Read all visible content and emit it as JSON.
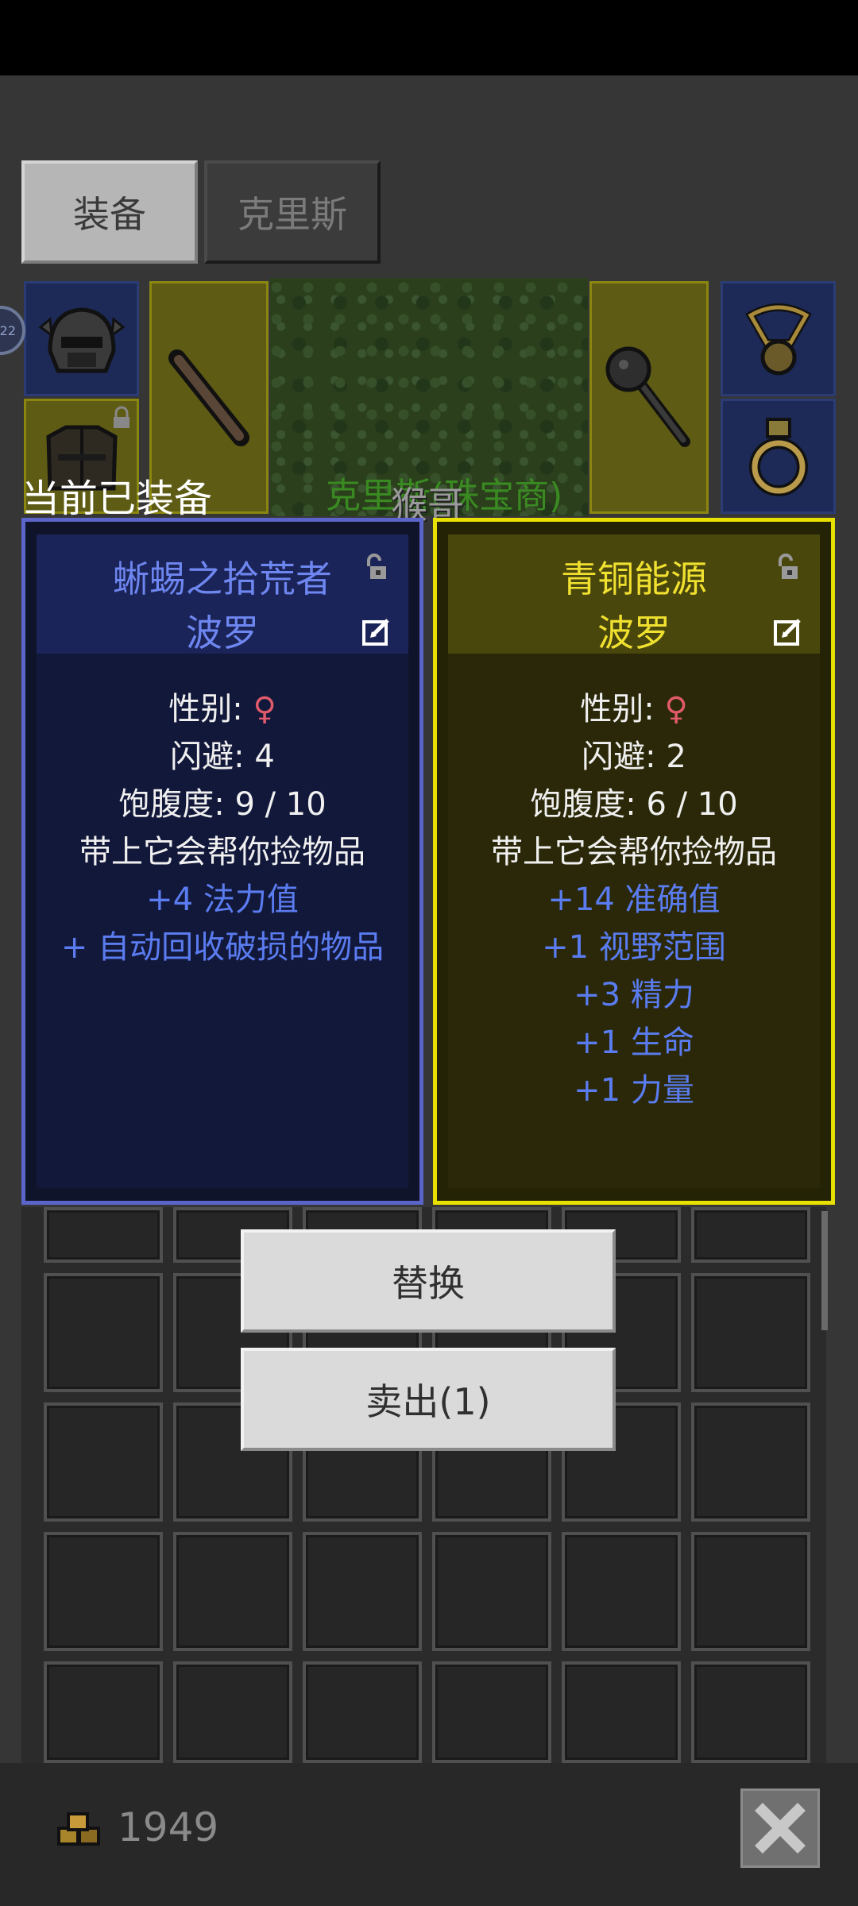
{
  "tabs": {
    "equipment": "装备",
    "chris": "克里斯"
  },
  "hero": {
    "level_badge": "22",
    "name": "克里斯(珠宝商)",
    "pet_name": "猴哥"
  },
  "current_equipped_label": "当前已装备",
  "cards": [
    {
      "title": "蜥蜴之拾荒者",
      "subtitle": "波罗",
      "gender_label": "性别: ",
      "gender_symbol": "♀",
      "stats": [
        "闪避: 4",
        "饱腹度: 9 / 10",
        "带上它会帮你捡物品"
      ],
      "bonuses": [
        "+4 法力值",
        "+ 自动回收破损的物品"
      ]
    },
    {
      "title": "青铜能源",
      "subtitle": "波罗",
      "gender_label": "性别: ",
      "gender_symbol": "♀",
      "stats": [
        "闪避: 2",
        "饱腹度: 6 / 10",
        "带上它会帮你捡物品"
      ],
      "bonuses": [
        "+14 准确值",
        "+1 视野范围",
        "+3 精力",
        "+1 生命",
        "+1 力量"
      ]
    }
  ],
  "buttons": {
    "replace": "替换",
    "sell": "卖出(1)"
  },
  "gold": "1949",
  "colors": {
    "left_card_border": "#5b64c8",
    "right_card_border": "#e8e000",
    "bonus_blue": "#5a7cf0",
    "female_symbol": "#e05a6a"
  },
  "icons": [
    "helmet-icon",
    "armor-icon",
    "club-weapon-icon",
    "mace-weapon-icon",
    "amulet-icon",
    "ring-icon",
    "lock-icon",
    "edit-icon",
    "gold-pile-icon",
    "close-icon"
  ]
}
